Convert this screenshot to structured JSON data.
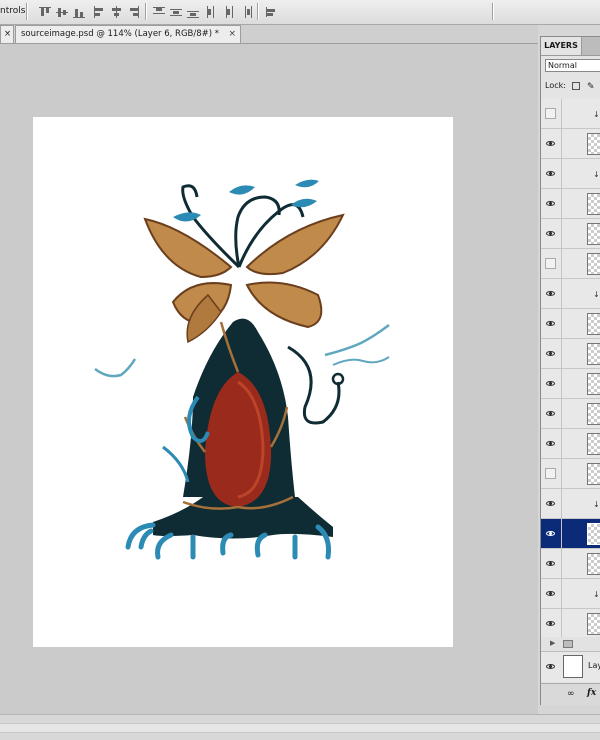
{
  "options_bar": {
    "tool_label": "ntrols"
  },
  "document_tab": {
    "title": "sourceimage.psd @ 114% (Layer 6, RGB/8#) *",
    "close_glyph": "×",
    "left_glyph": "×"
  },
  "layers_panel": {
    "tab_label": "LAYERS",
    "blend_mode": "Normal",
    "lock_label": "Lock:",
    "lock_brush_glyph": "✎",
    "background_layer_name": "Lay",
    "footer_link_glyph": "∞",
    "footer_fx": "fx",
    "group_arrow": "▶",
    "clip_glyph": "↓"
  },
  "colors": {
    "selected_layer": "#0b2a78",
    "canvas_bg": "#cbcbcb",
    "ui_chrome": "#e4e4e4"
  },
  "icons": [
    "close-icon",
    "eye-icon",
    "lock-pixels-icon",
    "lock-brush-icon",
    "link-layers-icon",
    "fx-icon",
    "group-folder-icon"
  ]
}
